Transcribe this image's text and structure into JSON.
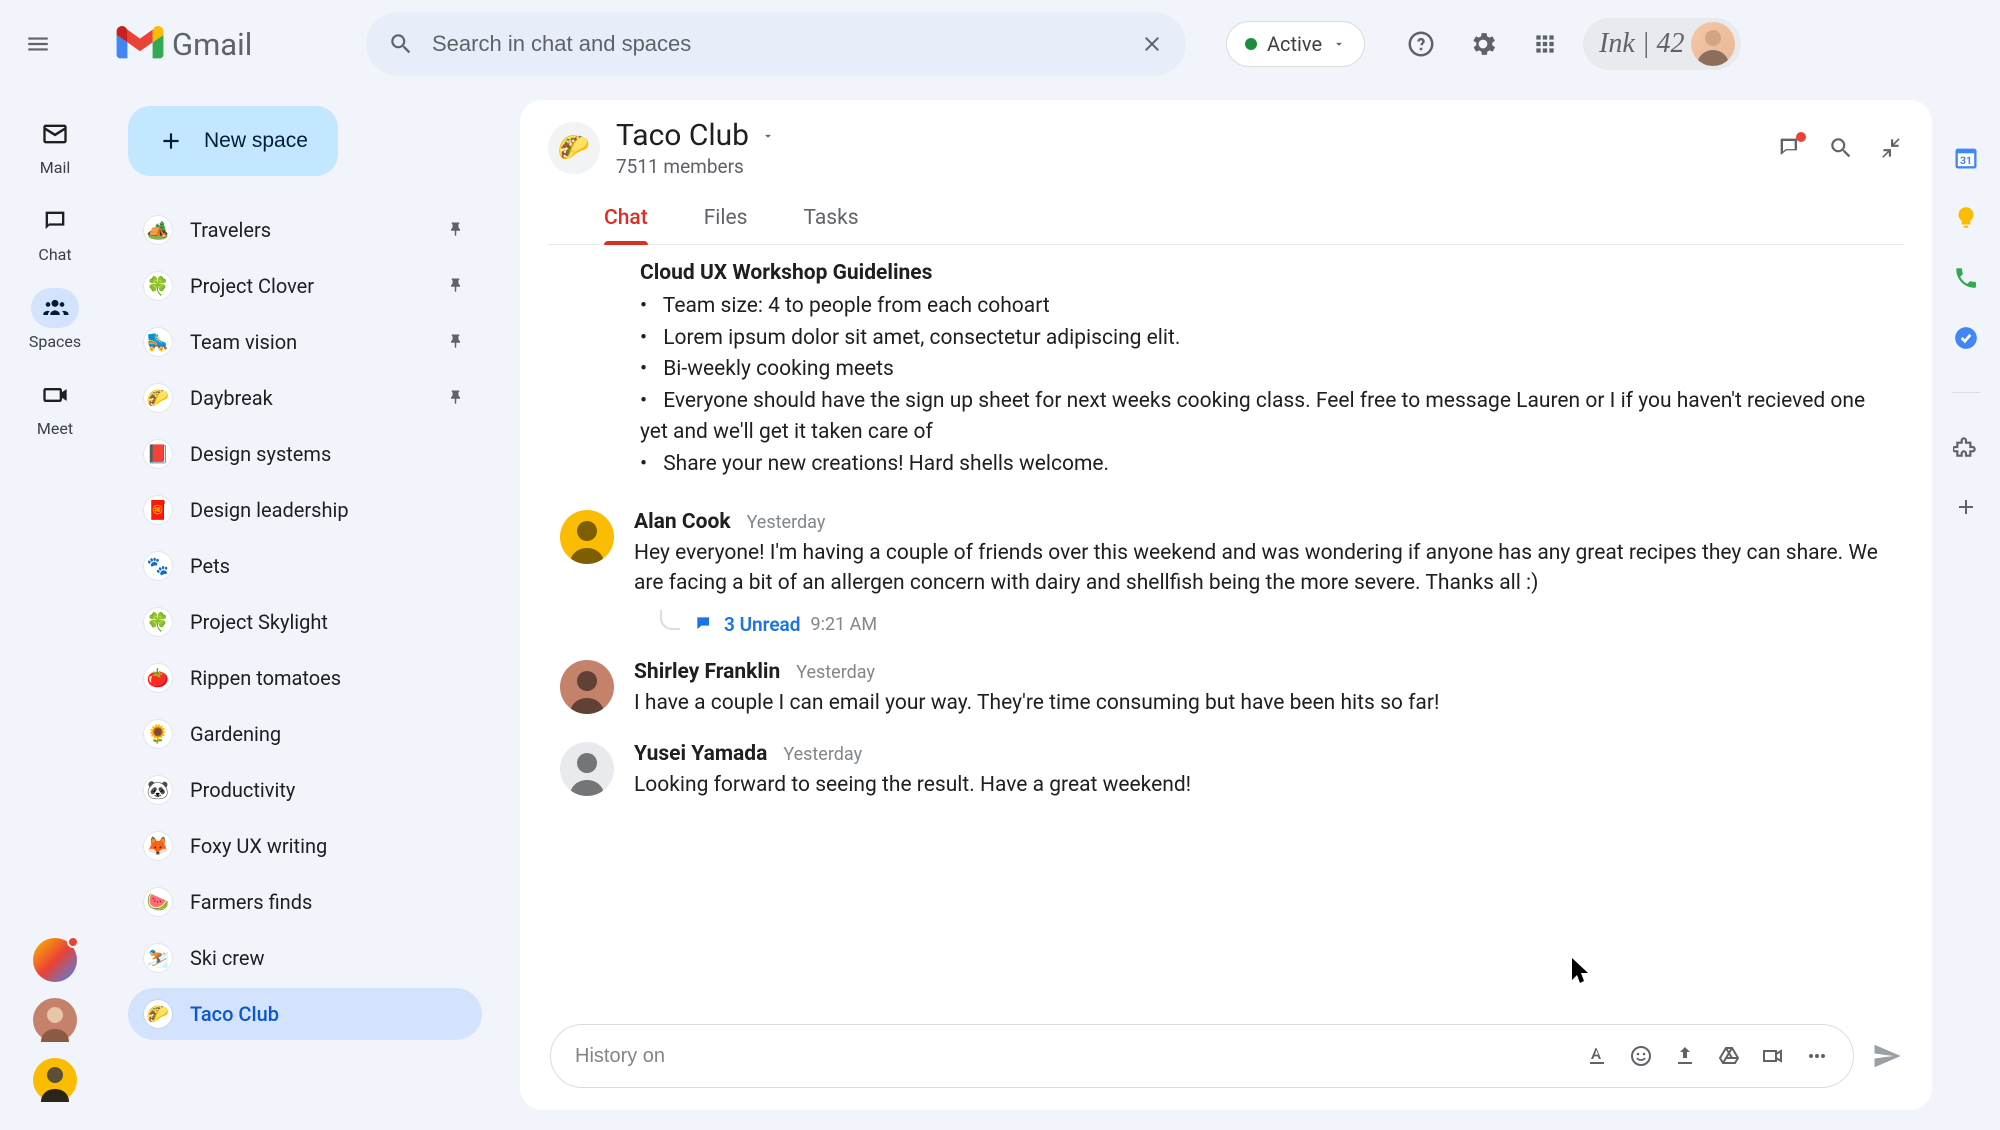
{
  "app": {
    "name": "Gmail"
  },
  "search": {
    "placeholder": "Search in chat and spaces"
  },
  "status": {
    "label": "Active"
  },
  "workspace": {
    "label": "Ink | 42"
  },
  "rail": {
    "mail": "Mail",
    "chat": "Chat",
    "spaces": "Spaces",
    "meet": "Meet"
  },
  "sidebar": {
    "new_space": "New space",
    "spaces": [
      {
        "emoji": "🏕️",
        "name": "Travelers",
        "pinned": true
      },
      {
        "emoji": "🍀",
        "name": "Project Clover",
        "pinned": true
      },
      {
        "emoji": "🛼",
        "name": "Team vision",
        "pinned": true
      },
      {
        "emoji": "🌮",
        "name": "Daybreak",
        "pinned": true
      },
      {
        "emoji": "📕",
        "name": "Design systems",
        "pinned": false
      },
      {
        "emoji": "🧧",
        "name": "Design leadership",
        "pinned": false
      },
      {
        "emoji": "🐾",
        "name": "Pets",
        "pinned": false
      },
      {
        "emoji": "🍀",
        "name": "Project Skylight",
        "pinned": false
      },
      {
        "emoji": "🍅",
        "name": "Rippen tomatoes",
        "pinned": false
      },
      {
        "emoji": "🌻",
        "name": "Gardening",
        "pinned": false
      },
      {
        "emoji": "🐼",
        "name": "Productivity",
        "pinned": false
      },
      {
        "emoji": "🦊",
        "name": "Foxy UX writing",
        "pinned": false
      },
      {
        "emoji": "🍉",
        "name": "Farmers finds",
        "pinned": false
      },
      {
        "emoji": "⛷️",
        "name": "Ski crew",
        "pinned": false
      },
      {
        "emoji": "🌮",
        "name": "Taco Club",
        "pinned": false
      }
    ],
    "selected_index": 14
  },
  "space": {
    "emoji": "🌮",
    "title": "Taco Club",
    "members": "7511 members",
    "tabs": [
      "Chat",
      "Files",
      "Tasks"
    ],
    "active_tab": 0
  },
  "guidelines": {
    "title": "Cloud UX Workshop Guidelines",
    "items": [
      "Team size: 4 to people from each cohoart",
      "Lorem ipsum dolor sit amet, consectetur adipiscing elit.",
      "Bi-weekly cooking meets",
      "Everyone should have the sign up sheet for next weeks cooking class. Feel free to message Lauren or I if you haven't recieved one yet and we'll get it taken care of",
      "Share your new creations! Hard shells welcome."
    ]
  },
  "messages": [
    {
      "author": "Alan Cook",
      "time": "Yesterday",
      "avatar_bg": "#fbbc04",
      "text": "Hey everyone! I'm having a couple of friends over this weekend and was wondering if anyone has any great recipes they can share. We are facing a bit of an allergen concern with dairy and shellfish being the more severe. Thanks all :)",
      "thread": {
        "label": "3 Unread",
        "time": "9:21 AM"
      }
    },
    {
      "author": "Shirley Franklin",
      "time": "Yesterday",
      "avatar_bg": "#c5826a",
      "text": "I have a couple I can email your way. They're time consuming but have been hits so far!"
    },
    {
      "author": "Yusei Yamada",
      "time": "Yesterday",
      "avatar_bg": "#e8eaed",
      "text": "Looking forward to seeing the result. Have a great weekend!"
    }
  ],
  "composer": {
    "placeholder": "History on"
  }
}
